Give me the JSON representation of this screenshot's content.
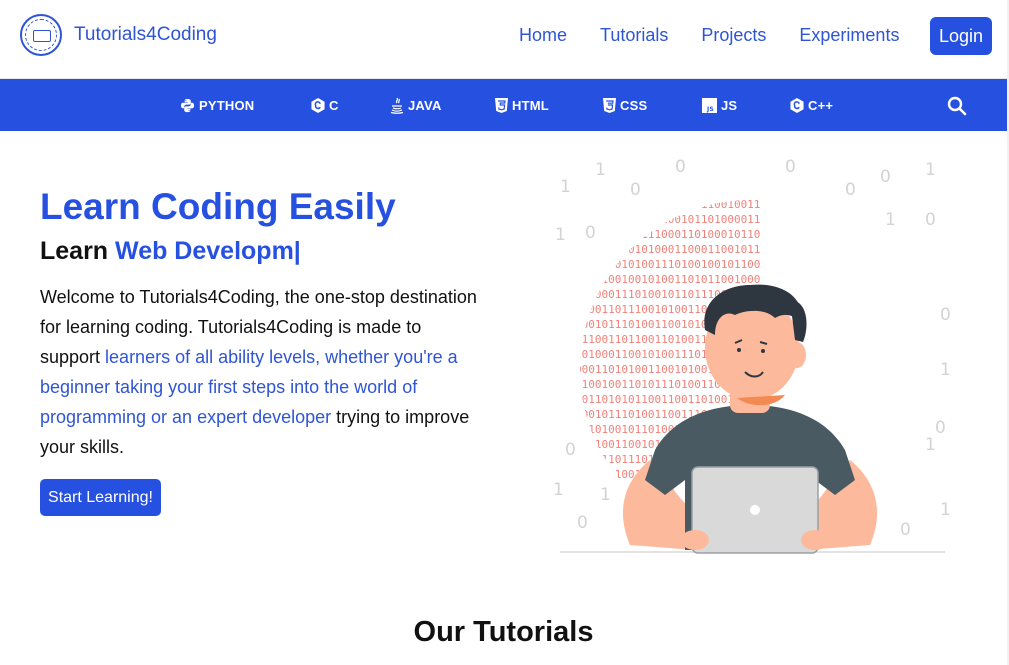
{
  "brand": {
    "name": "Tutorials4Coding",
    "logo_text": "Tutorials4Coding"
  },
  "nav": {
    "links": [
      "Home",
      "Tutorials",
      "Projects",
      "Experiments"
    ],
    "login_label": "Login"
  },
  "languages": [
    {
      "label": "PYTHON",
      "icon": "python-icon"
    },
    {
      "label": "C",
      "icon": "c-icon"
    },
    {
      "label": "JAVA",
      "icon": "java-icon"
    },
    {
      "label": "HTML",
      "icon": "html5-icon"
    },
    {
      "label": "CSS",
      "icon": "css3-icon"
    },
    {
      "label": "JS",
      "icon": "js-icon"
    },
    {
      "label": "C++",
      "icon": "cpp-icon"
    }
  ],
  "hero": {
    "title": "Learn Coding Easily",
    "subtitle_prefix": "Learn",
    "subtitle_typed": "Web Developm|",
    "desc_part1": "Welcome to Tutorials4Coding, the one-stop destination for learning coding. Tutorials4Coding is made to support ",
    "desc_highlight": "learners of all ability levels, whether you're a beginner taking your first steps into the world of programming or an expert developer",
    "desc_part2": " trying to improve your skills.",
    "cta_label": "Start Learning!"
  },
  "section": {
    "title": "Our Tutorials"
  },
  "colors": {
    "primary": "#2650e0",
    "link": "#2f55d4",
    "binary": "#f0827a",
    "shirt": "#4a5a63",
    "skin": "#fdb99b"
  }
}
